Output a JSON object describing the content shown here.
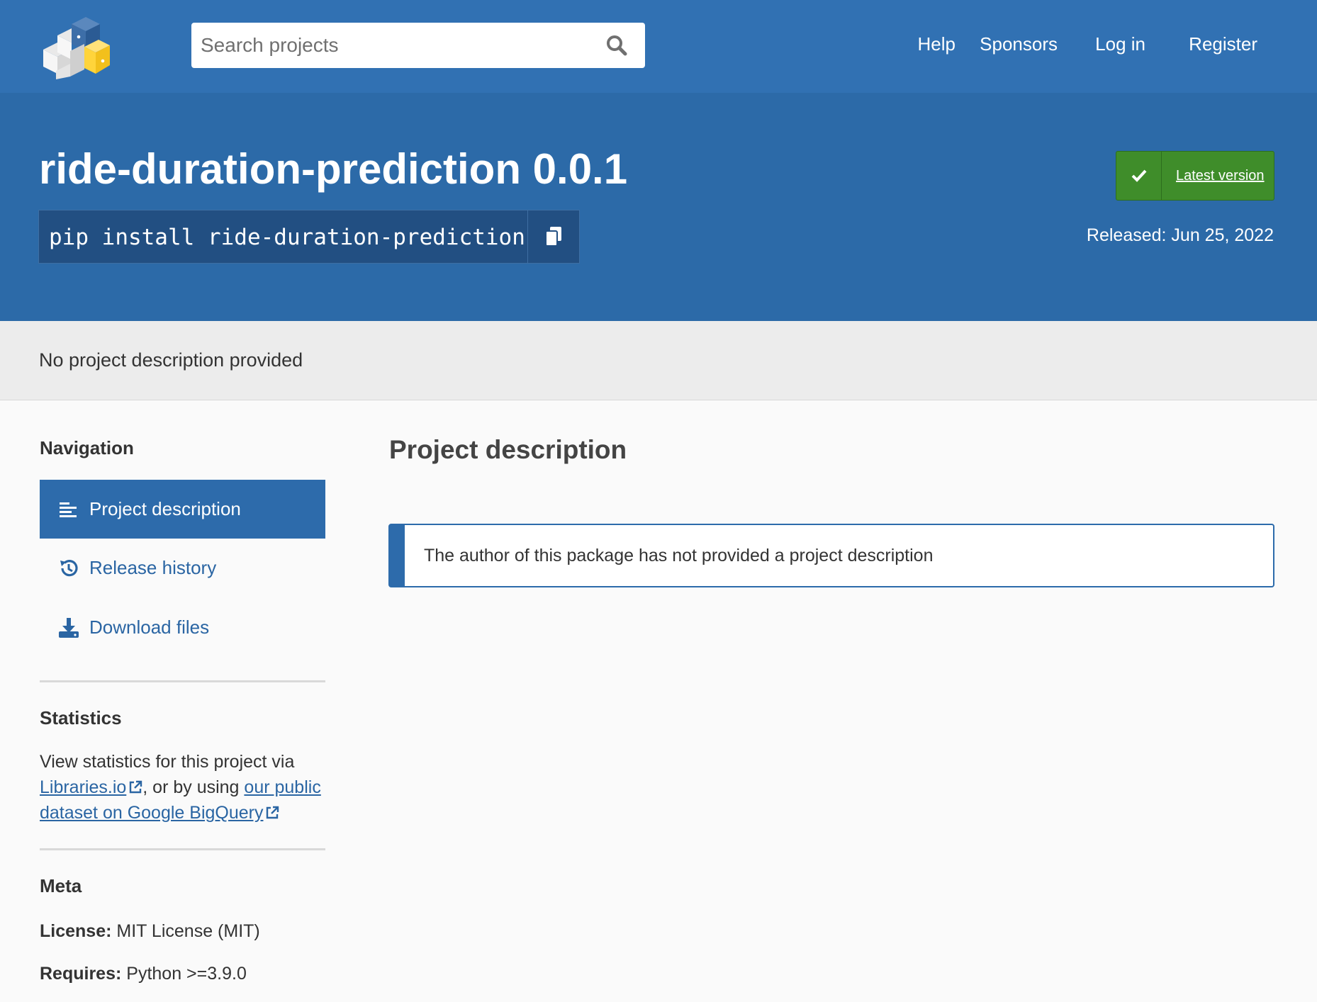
{
  "header": {
    "logo_alt": "PyPI",
    "search_placeholder": "Search projects",
    "nav": [
      "Help",
      "Sponsors",
      "Log in",
      "Register"
    ]
  },
  "package": {
    "title": "ride-duration-prediction 0.0.1",
    "pip_command": "pip install ride-duration-prediction",
    "latest_version_label": "Latest version",
    "released": "Released: Jun 25, 2022",
    "summary": "No project description provided"
  },
  "sidebar": {
    "navigation_heading": "Navigation",
    "nav_items": [
      {
        "label": "Project description",
        "icon": "align-left-icon",
        "active": true
      },
      {
        "label": "Release history",
        "icon": "history-icon",
        "active": false
      },
      {
        "label": "Download files",
        "icon": "download-icon",
        "active": false
      }
    ],
    "statistics_heading": "Statistics",
    "statistics_intro": "View statistics for this project via",
    "statistics_link_1": "Libraries.io",
    "statistics_mid": ", or by using",
    "statistics_link_2": "our public dataset on Google BigQuery",
    "meta_heading": "Meta",
    "license_label": "License:",
    "license_value": "MIT License (MIT)",
    "requires_label": "Requires:",
    "requires_value": "Python >=3.9.0"
  },
  "main": {
    "heading": "Project description",
    "callout": "The author of this package has not provided a project description"
  },
  "colors": {
    "header_blue": "#3171b3",
    "banner_blue": "#2c6aa8",
    "latest_green": "#3f8d2a",
    "link_blue": "#2a65a3"
  }
}
